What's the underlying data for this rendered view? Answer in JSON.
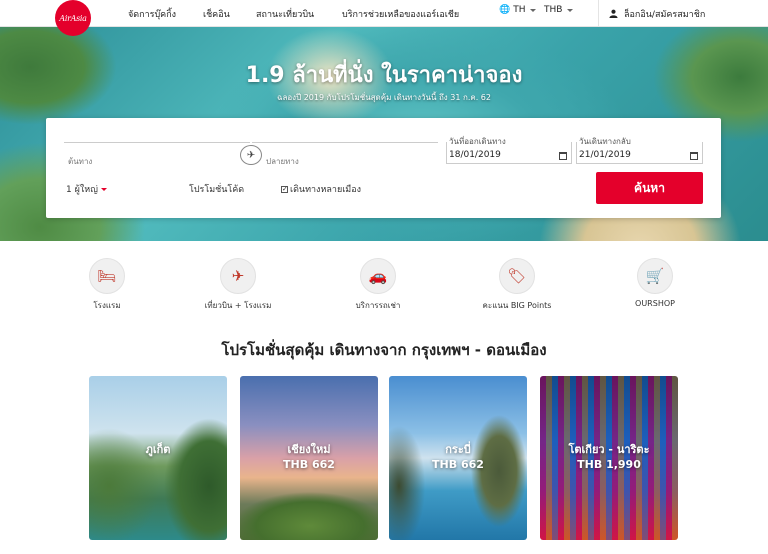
{
  "brand": {
    "logo_text": "AirAsia",
    "accent": "#e4002b"
  },
  "nav": {
    "items": [
      "จัดการบุ๊คกิ้ง",
      "เช็คอิน",
      "สถานะเที่ยวบิน",
      "บริการช่วยเหลือของแอร์เอเชีย"
    ],
    "language": "TH",
    "currency": "THB",
    "login": "ล็อกอิน/สมัครสมาชิก"
  },
  "hero": {
    "title": "1.9 ล้านที่นั่ง ในราคาน่าจอง",
    "subtitle": "ฉลองปี 2019 กับโปรโมชั่นสุดคุ้ม เดินทางวันนี้ ถึง 31 ก.ค. 62"
  },
  "search": {
    "origin_label": "ต้นทาง",
    "destination_label": "ปลายทาง",
    "depart_label": "วันที่ออกเดินทาง",
    "depart_value": "18/01/2019",
    "return_label": "วันเดินทางกลับ",
    "return_value": "21/01/2019",
    "passengers": "1 ผู้ใหญ่",
    "promo_code": "โปรโมชั่นโค้ด",
    "multi_city": "เดินทางหลายเมือง",
    "search_button": "ค้นหา"
  },
  "services": [
    {
      "label": "โรงแรม",
      "icon": "hotel-icon",
      "glyph": "🛏"
    },
    {
      "label": "เที่ยวบิน + โรงแรม",
      "icon": "flight-hotel-icon",
      "glyph": "✈"
    },
    {
      "label": "บริการรถเช่า",
      "icon": "car-rental-icon",
      "glyph": "🚗"
    },
    {
      "label": "คะแนน BIG Points",
      "icon": "big-points-icon",
      "glyph": "🏷"
    },
    {
      "label": "OURSHOP",
      "icon": "shopping-cart-icon",
      "glyph": "🛒"
    }
  ],
  "promotions": {
    "title": "โปรโมชั่นสุดคุ้ม เดินทางจาก กรุงเทพฯ - ดอนเมือง",
    "cards": [
      {
        "city": "ภูเก็ต",
        "price": ""
      },
      {
        "city": "เชียงใหม่",
        "price": "THB 662"
      },
      {
        "city": "กระบี่",
        "price": "THB 662"
      },
      {
        "city": "โตเกียว - นาริตะ",
        "price": "THB 1,990"
      }
    ]
  }
}
